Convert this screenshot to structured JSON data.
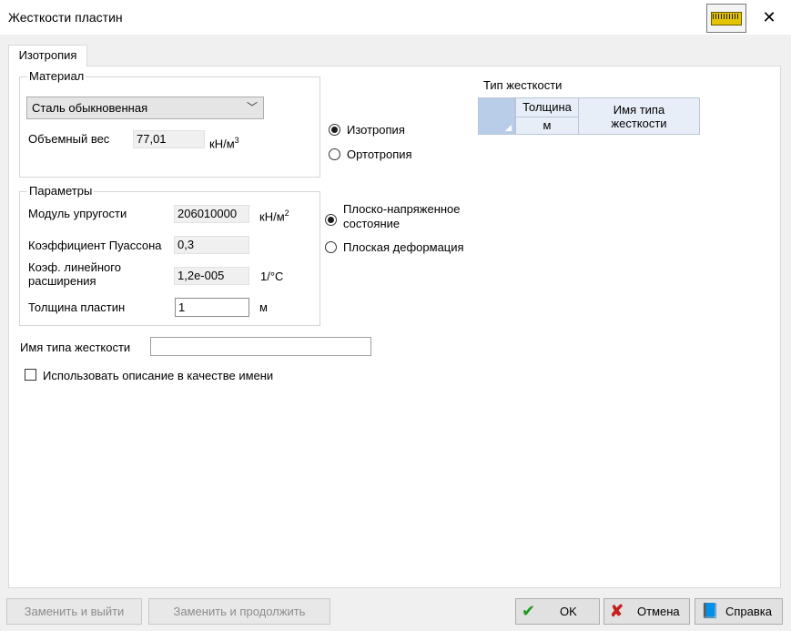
{
  "window": {
    "title": "Жесткости пластин"
  },
  "tabs": [
    {
      "label": "Изотропия"
    }
  ],
  "material": {
    "legend": "Материал",
    "selected": "Сталь обыкновенная",
    "volume_weight_label": "Объемный вес",
    "volume_weight_value": "77,01",
    "volume_weight_unit": "кН/м",
    "volume_weight_unit_sup": "3"
  },
  "material_type": {
    "isotropy": "Изотропия",
    "orthotropy": "Ортотропия",
    "selected": "isotropy"
  },
  "parameters": {
    "legend": "Параметры",
    "elastic_modulus_label": "Модуль упругости",
    "elastic_modulus_value": "206010000",
    "elastic_modulus_unit": "кН/м",
    "elastic_modulus_unit_sup": "2",
    "poisson_label": "Коэффициент Пуассона",
    "poisson_value": "0,3",
    "expansion_label_1": "Коэф. линейного",
    "expansion_label_2": "расширения",
    "expansion_value": "1,2e-005",
    "expansion_unit": "1/°C",
    "thickness_label": "Толщина пластин",
    "thickness_value": "1",
    "thickness_unit": "м"
  },
  "state": {
    "plane_stress_1": "Плоско-напряженное",
    "plane_stress_2": "состояние",
    "plane_strain": "Плоская деформация",
    "selected": "plane_stress"
  },
  "stiffness_name": {
    "label": "Имя типа жесткости",
    "value": ""
  },
  "use_description": {
    "label": "Использовать описание в качестве имени",
    "checked": false
  },
  "stiffness_table": {
    "title": "Тип жесткости",
    "col1_header": "Толщина",
    "col1_unit": "м",
    "col2_header_1": "Имя типа",
    "col2_header_2": "жесткости"
  },
  "buttons": {
    "replace_exit": "Заменить и выйти",
    "replace_continue": "Заменить и продолжить",
    "ok": "OK",
    "cancel": "Отмена",
    "help": "Справка"
  },
  "icons": {
    "ruler": "ruler-icon",
    "close": "close-icon",
    "ok": "check-icon",
    "cancel": "x-icon",
    "help": "book-icon"
  },
  "colors": {
    "ok_green": "#1f9a1f",
    "cancel_red": "#c81e1e",
    "ruler_yellow": "#e4c400"
  }
}
